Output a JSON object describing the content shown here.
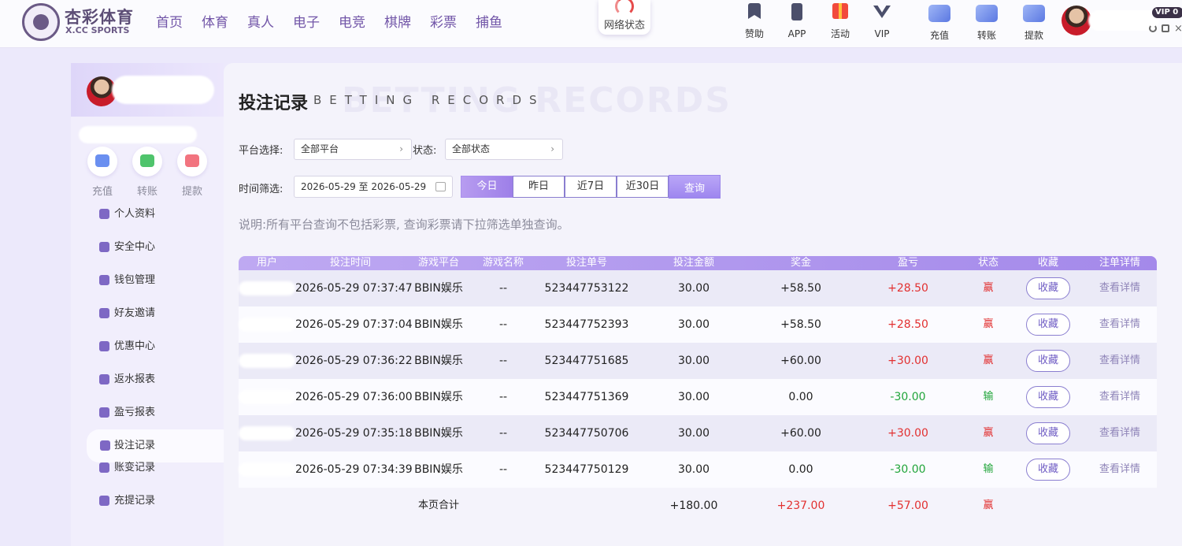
{
  "brand": {
    "name": "杏彩体育",
    "sub": "X.CC SPORTS"
  },
  "nav": [
    "首页",
    "体育",
    "真人",
    "电子",
    "电竞",
    "棋牌",
    "彩票",
    "捕鱼"
  ],
  "net_status": "网络状态",
  "quick_links": [
    {
      "label": "赞助",
      "icon": "bookmark-icon"
    },
    {
      "label": "APP",
      "icon": "phone-icon"
    },
    {
      "label": "活动",
      "icon": "gift-icon"
    },
    {
      "label": "VIP",
      "icon": "vip-icon"
    }
  ],
  "wallet_links": [
    {
      "label": "充值",
      "icon": "deposit-icon"
    },
    {
      "label": "转账",
      "icon": "transfer-icon"
    },
    {
      "label": "提款",
      "icon": "withdraw-icon"
    }
  ],
  "user": {
    "vip": "VIP 0"
  },
  "sidebar": {
    "actions": [
      {
        "label": "充值",
        "icon": "deposit-icon",
        "color": "#6a8ff0"
      },
      {
        "label": "转账",
        "icon": "transfer-icon",
        "color": "#4fc46c"
      },
      {
        "label": "提款",
        "icon": "withdraw-icon",
        "color": "#f2747f"
      }
    ],
    "menu": [
      {
        "label": "个人资料",
        "icon": "profile-icon"
      },
      {
        "label": "安全中心",
        "icon": "shield-icon"
      },
      {
        "label": "钱包管理",
        "icon": "wallet-icon"
      },
      {
        "label": "好友邀请",
        "icon": "invite-icon"
      },
      {
        "label": "优惠中心",
        "icon": "coupon-icon"
      },
      {
        "label": "返水报表",
        "icon": "rebate-icon"
      },
      {
        "label": "盈亏报表",
        "icon": "report-icon"
      },
      {
        "label": "投注记录",
        "icon": "record-icon"
      },
      {
        "label": "账变记录",
        "icon": "ledger-icon"
      },
      {
        "label": "充提记录",
        "icon": "history-icon"
      }
    ]
  },
  "page": {
    "title": "投注记录",
    "title_en": "BETTING RECORDS"
  },
  "filters": {
    "platform_label": "平台选择:",
    "platform_value": "全部平台",
    "status_label": "状态:",
    "status_value": "全部状态",
    "time_label": "时间筛选:",
    "date_range": "2026-05-29 至 2026-05-29",
    "quick_ranges": [
      "今日",
      "昨日",
      "近7日",
      "近30日"
    ],
    "active_range": "今日",
    "query_label": "查询"
  },
  "note": "说明:所有平台查询不包括彩票, 查询彩票请下拉筛选单独查询。",
  "table": {
    "columns": [
      "用户",
      "投注时间",
      "游戏平台",
      "游戏名称",
      "投注单号",
      "投注金额",
      "奖金",
      "盈亏",
      "状态",
      "收藏",
      "注单详情"
    ],
    "rows": [
      {
        "time": "2026-05-29 07:37:47",
        "platform": "BBIN娱乐",
        "game": "--",
        "order": "523447753122",
        "amount": "30.00",
        "bonus": "+58.50",
        "pnl": "+28.50",
        "status": "赢",
        "fav": "收藏",
        "detail": "查看详情"
      },
      {
        "time": "2026-05-29 07:37:04",
        "platform": "BBIN娱乐",
        "game": "--",
        "order": "523447752393",
        "amount": "30.00",
        "bonus": "+58.50",
        "pnl": "+28.50",
        "status": "赢",
        "fav": "收藏",
        "detail": "查看详情"
      },
      {
        "time": "2026-05-29 07:36:22",
        "platform": "BBIN娱乐",
        "game": "--",
        "order": "523447751685",
        "amount": "30.00",
        "bonus": "+60.00",
        "pnl": "+30.00",
        "status": "赢",
        "fav": "收藏",
        "detail": "查看详情"
      },
      {
        "time": "2026-05-29 07:36:00",
        "platform": "BBIN娱乐",
        "game": "--",
        "order": "523447751369",
        "amount": "30.00",
        "bonus": "0.00",
        "pnl": "-30.00",
        "status": "输",
        "fav": "收藏",
        "detail": "查看详情"
      },
      {
        "time": "2026-05-29 07:35:18",
        "platform": "BBIN娱乐",
        "game": "--",
        "order": "523447750706",
        "amount": "30.00",
        "bonus": "+60.00",
        "pnl": "+30.00",
        "status": "赢",
        "fav": "收藏",
        "detail": "查看详情"
      },
      {
        "time": "2026-05-29 07:34:39",
        "platform": "BBIN娱乐",
        "game": "--",
        "order": "523447750129",
        "amount": "30.00",
        "bonus": "0.00",
        "pnl": "-30.00",
        "status": "输",
        "fav": "收藏",
        "detail": "查看详情"
      }
    ],
    "total": {
      "label": "本页合计",
      "amount": "+180.00",
      "bonus": "+237.00",
      "pnl": "+57.00",
      "status": "赢"
    }
  },
  "colors": {
    "accent": "#9d7fe8",
    "win": "#e23030",
    "lose": "#21a53a",
    "nav": "#7256a8"
  }
}
